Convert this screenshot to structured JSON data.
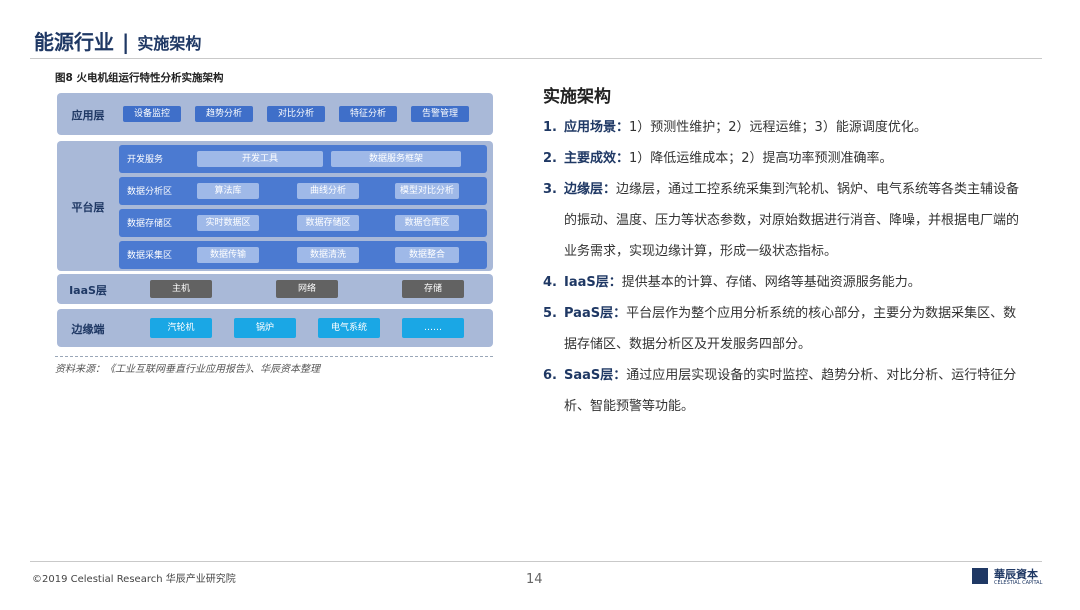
{
  "header": {
    "title": "能源行业",
    "separator": "|",
    "subtitle": "实施架构"
  },
  "figure": {
    "caption": "图8 火电机组运行特性分析实施架构",
    "source": "资料来源：《工业互联网垂直行业应用报告》、华辰资本整理",
    "layers": {
      "app": {
        "label": "应用层",
        "items": [
          "设备监控",
          "趋势分析",
          "对比分析",
          "特征分析",
          "告警管理"
        ]
      },
      "platform": {
        "label": "平台层",
        "rows": [
          {
            "label": "开发服务",
            "items": [
              "开发工具",
              "数据服务框架"
            ]
          },
          {
            "label": "数据分析区",
            "items": [
              "算法库",
              "曲线分析",
              "模型对比分析"
            ]
          },
          {
            "label": "数据存储区",
            "items": [
              "实时数据区",
              "数据存储区",
              "数据仓库区"
            ]
          },
          {
            "label": "数据采集区",
            "items": [
              "数据传输",
              "数据清洗",
              "数据整合"
            ]
          }
        ]
      },
      "iaas": {
        "label": "IaaS层",
        "items": [
          "主机",
          "网络",
          "存储"
        ]
      },
      "edge": {
        "label": "边缘端",
        "items": [
          "汽轮机",
          "锅炉",
          "电气系统",
          "……"
        ]
      }
    }
  },
  "implementation": {
    "title": "实施架构",
    "items": [
      {
        "num": "1.",
        "key": "应用场景：",
        "text": "1）预测性维护；2）远程运维；3）能源调度优化。"
      },
      {
        "num": "2.",
        "key": "主要成效：",
        "text": "1）降低运维成本；2）提高功率预测准确率。"
      },
      {
        "num": "3.",
        "key": "边缘层：",
        "text": "边缘层，通过工控系统采集到汽轮机、锅炉、电气系统等各类主辅设备的振动、温度、压力等状态参数，对原始数据进行消音、降噪，并根据电厂端的业务需求，实现边缘计算，形成一级状态指标。"
      },
      {
        "num": "4.",
        "key": "IaaS层：",
        "text": "提供基本的计算、存储、网络等基础资源服务能力。"
      },
      {
        "num": "5.",
        "key": "PaaS层：",
        "text": "平台层作为整个应用分析系统的核心部分，主要分为数据采集区、数据存储区、数据分析区及开发服务四部分。"
      },
      {
        "num": "6.",
        "key": "SaaS层：",
        "text": "通过应用层实现设备的实时监控、趋势分析、对比分析、运行特征分析、智能预警等功能。"
      }
    ]
  },
  "footer": {
    "copyright": "©2019 Celestial Research 华辰产业研究院",
    "page": "14",
    "logo_cn": "華辰資本",
    "logo_en": "CELESTIAL CAPITAL"
  }
}
